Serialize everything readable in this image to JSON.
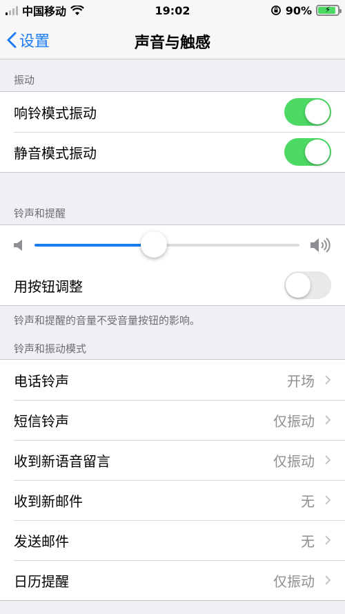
{
  "status_bar": {
    "carrier": "中国移动",
    "time": "19:02",
    "battery_percent": "90%",
    "battery_level": 0.9
  },
  "nav": {
    "back_label": "设置",
    "title": "声音与触感"
  },
  "vibration": {
    "header": "振动",
    "items": [
      {
        "label": "响铃模式振动",
        "on": true
      },
      {
        "label": "静音模式振动",
        "on": true
      }
    ]
  },
  "ringer": {
    "header": "铃声和提醒",
    "volume_level": 0.45,
    "buttons_label": "用按钮调整",
    "buttons_on": false,
    "note": "铃声和提醒的音量不受音量按钮的影响。"
  },
  "patterns": {
    "header": "铃声和振动模式",
    "items": [
      {
        "label": "电话铃声",
        "value": "开场"
      },
      {
        "label": "短信铃声",
        "value": "仅振动"
      },
      {
        "label": "收到新语音留言",
        "value": "仅振动"
      },
      {
        "label": "收到新邮件",
        "value": "无"
      },
      {
        "label": "发送邮件",
        "value": "无"
      },
      {
        "label": "日历提醒",
        "value": "仅振动"
      }
    ]
  },
  "colors": {
    "accent": "#1a7cf5",
    "toggle_on": "#4cd964",
    "background": "#efeff4"
  }
}
